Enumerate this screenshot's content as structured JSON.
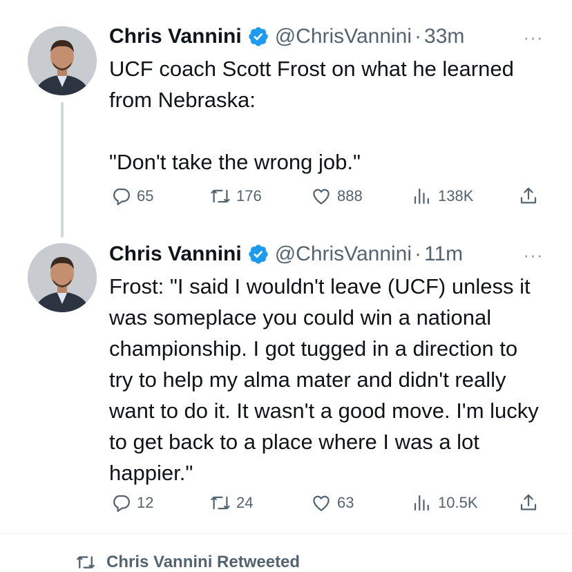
{
  "tweets": [
    {
      "author_name": "Chris Vannini",
      "handle": "@ChrisVannini",
      "separator": "·",
      "time": "33m",
      "more_label": "···",
      "text": "UCF coach Scott Frost on what he learned from Nebraska:\n\n\"Don't take the wrong job.\"",
      "replies": "65",
      "retweets": "176",
      "likes": "888",
      "views": "138K"
    },
    {
      "author_name": "Chris Vannini",
      "handle": "@ChrisVannini",
      "separator": "·",
      "time": "11m",
      "more_label": "···",
      "text": "Frost: \"I said I wouldn't leave (UCF) unless it was someplace you could win a national championship. I got tugged in a direction to try to help my alma mater and didn't really want to do it. It wasn't a good move. I'm lucky to get back to a place where I was a lot happier.\"",
      "replies": "12",
      "retweets": "24",
      "likes": "63",
      "views": "10.5K"
    }
  ],
  "next_item": {
    "label": "Chris Vannini Retweeted"
  },
  "colors": {
    "verified": "#1d9bf0",
    "secondary_text": "#536471",
    "thread_line": "#cfd9de"
  }
}
